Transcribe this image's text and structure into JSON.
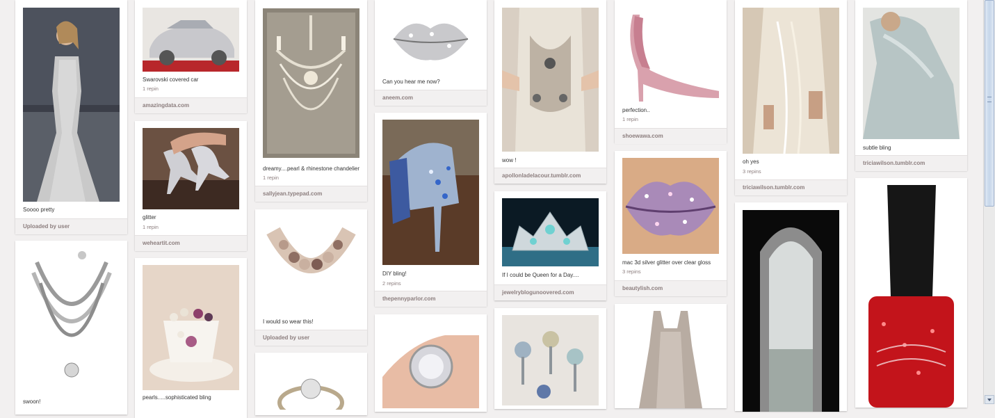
{
  "pins": [
    {
      "desc": "Soooo pretty",
      "repins": "",
      "source": "Uploaded by user"
    },
    {
      "desc": "swoon!",
      "repins": "",
      "source": ""
    },
    {
      "desc": "Swarovski covered car",
      "repins": "1 repin",
      "source": "amazingdata.com"
    },
    {
      "desc": "glitter",
      "repins": "1 repin",
      "source": "weheartit.com"
    },
    {
      "desc": "pearls.....sophisticated bling",
      "repins": "",
      "source": ""
    },
    {
      "desc": "dreamy....pearl & rhinestone chandelier",
      "repins": "1 repin",
      "source": "sallyjean.typepad.com"
    },
    {
      "desc": "I would so wear this!",
      "repins": "",
      "source": "Uploaded by user"
    },
    {
      "desc": "",
      "repins": "",
      "source": ""
    },
    {
      "desc": "Can you hear me now?",
      "repins": "",
      "source": "aneem.com"
    },
    {
      "desc": "DIY bling!",
      "repins": "2 repins",
      "source": "thepennyparlor.com"
    },
    {
      "desc": "",
      "repins": "",
      "source": ""
    },
    {
      "desc": "wow !",
      "repins": "",
      "source": "apollonladelacour.tumblr.com"
    },
    {
      "desc": "If I could be Queen for a Day....",
      "repins": "",
      "source": "jewelryblogunoovered.com"
    },
    {
      "desc": "",
      "repins": "",
      "source": ""
    },
    {
      "desc": "perfection..",
      "repins": "1 repin",
      "source": "shoewawa.com"
    },
    {
      "desc": "mac 3d silver glitter over clear gloss",
      "repins": "3 repins",
      "source": "beautylish.com"
    },
    {
      "desc": "",
      "repins": "",
      "source": ""
    },
    {
      "desc": "oh yes",
      "repins": "3 repins",
      "source": "triciawilson.tumblr.com"
    },
    {
      "desc": "",
      "repins": "",
      "source": ""
    },
    {
      "desc": "subtle bling",
      "repins": "",
      "source": "triciawilson.tumblr.com"
    },
    {
      "desc": "",
      "repins": "",
      "source": ""
    }
  ],
  "colors": {
    "background": "#f2f0f0",
    "card": "#ffffff",
    "source_text": "#8c7e7e",
    "scroll_thumb": "#c6d6ea"
  }
}
